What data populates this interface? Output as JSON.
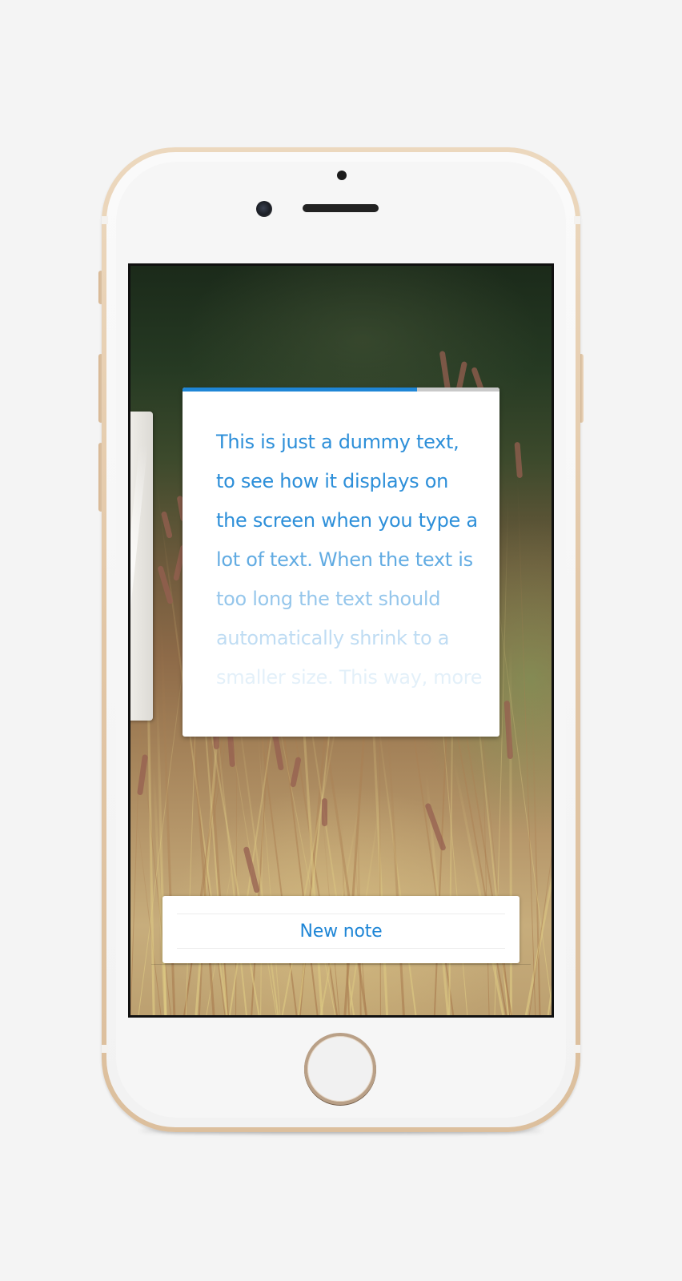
{
  "note": {
    "lines": [
      "This is just a dummy text,",
      "to see how it displays on",
      "the screen when you type a",
      "lot of text. When the text is",
      "too long the text should",
      "automatically shrink to a",
      "smaller size. This way, more"
    ],
    "progress": 0.74,
    "text_color": "#2d8fd9"
  },
  "actions": {
    "new_note_label": "New note"
  },
  "colors": {
    "accent": "#1f86d6",
    "phone_frame": "#e2c6a5"
  }
}
